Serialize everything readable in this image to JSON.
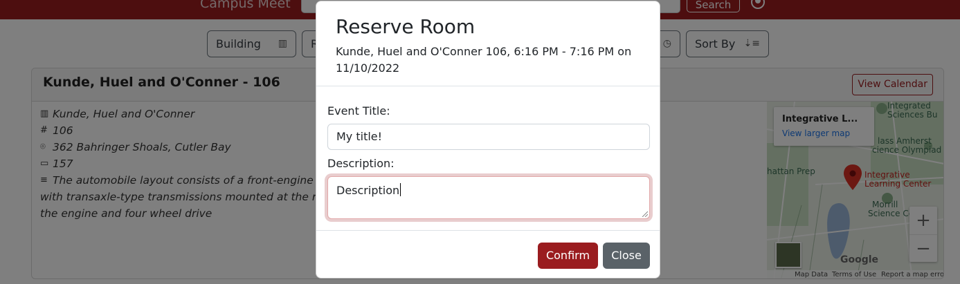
{
  "navbar": {
    "brand": "Campus Meet",
    "search_placeholder": "Search",
    "search_button": "Search"
  },
  "filters": {
    "building_label": "Building",
    "room_label": "R",
    "sort_label": "Sort By"
  },
  "room_card": {
    "title": "Kunde, Huel and O'Conner - 106",
    "view_calendar": "View Calendar",
    "building": "Kunde, Huel and O'Conner",
    "room_number": "106",
    "address": "362 Bahringer Shoals, Cutler Bay",
    "capacity": "157",
    "description_lines": [
      "The automobile layout consists of a front-engine desig",
      "with transaxle-type transmissions mounted at the rear o",
      "the engine and four wheel drive"
    ]
  },
  "map": {
    "place_name": "Integrative L...",
    "view_larger": "View larger map",
    "labels": [
      "Integrated",
      "Sciences Bu",
      "lass Amherst",
      "cience Olympiad",
      "hattan Prep",
      "Integrative",
      "Learning Center",
      "Morrill",
      "Science Cen"
    ],
    "google": "Google",
    "footer": [
      "Map Data",
      "Terms of Use",
      "Report a map error"
    ],
    "zoom_in": "+",
    "zoom_out": "−",
    "colors": {
      "pin": "#d93025",
      "water": "#9ab6d8",
      "green": "#c9dfc3"
    }
  },
  "modal": {
    "title": "Reserve Room",
    "subtitle": "Kunde, Huel and O'Conner 106, 6:16 PM - 7:16 PM on 11/10/2022",
    "event_title_label": "Event Title:",
    "event_title_value": "My title!",
    "description_label": "Description:",
    "description_value": "Description",
    "confirm_button": "Confirm",
    "close_button": "Close"
  },
  "theme": {
    "brand_color": "#9a1c1f",
    "secondary_color": "#5a6268"
  }
}
